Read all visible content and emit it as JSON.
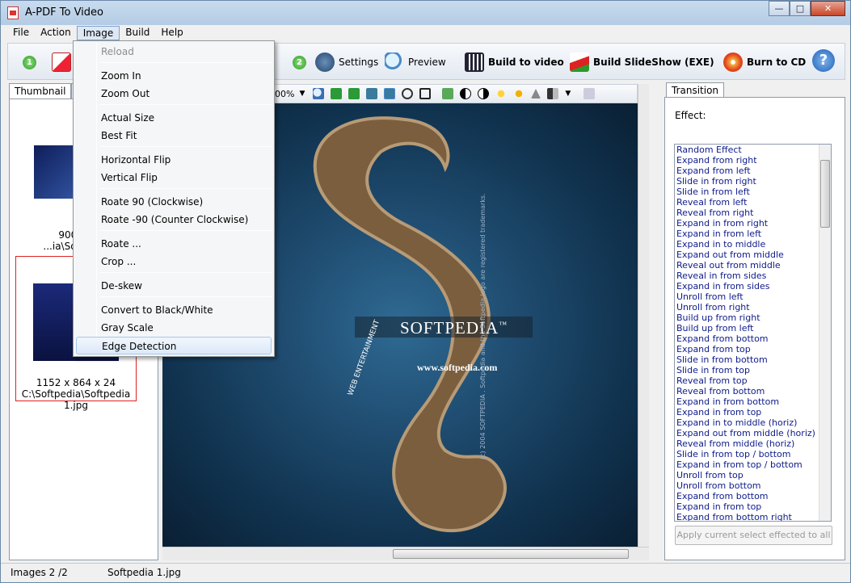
{
  "window": {
    "title": "A-PDF To Video",
    "min": "—",
    "max": "□",
    "close": "✕"
  },
  "menubar": [
    "File",
    "Action",
    "Image",
    "Build",
    "Help"
  ],
  "toolbar": {
    "step1": "1",
    "step2": "2",
    "settings": "Settings",
    "preview": "Preview",
    "build_video": "Build to video",
    "build_slideshow": "Build SlideShow (EXE)",
    "burn_cd": "Burn to CD",
    "help": "?"
  },
  "left_tabs": [
    "Thumbnail",
    "Mu"
  ],
  "thumbnails": [
    {
      "dims": "900 x 5",
      "path": "...ia\\Softpedia"
    },
    {
      "dims": "1152 x 864 x 24",
      "path": "C:\\Softpedia\\Softpedia 1.jpg"
    }
  ],
  "image_toolbar": {
    "zoom": "00%"
  },
  "canvas_text": {
    "brand": "SOFTPEDIA",
    "tm": "™",
    "web": "WEB  ENTERTAINMENT",
    "url": "www.softpedia.com",
    "side_note": "(c) 2004 SOFTPEDIA . Softpedia and the Softpedia logo are registered trademarks."
  },
  "image_menu": {
    "items": [
      {
        "label": "Reload",
        "disabled": true
      },
      {
        "label": "Zoom In"
      },
      {
        "label": "Zoom Out"
      },
      {
        "label": "Actual Size"
      },
      {
        "label": "Best Fit"
      },
      {
        "label": "Horizontal Flip"
      },
      {
        "label": "Vertical Flip"
      },
      {
        "label": "Roate 90 (Clockwise)"
      },
      {
        "label": "Roate -90 (Counter Clockwise)"
      },
      {
        "label": "Roate ..."
      },
      {
        "label": "Crop ..."
      },
      {
        "label": "De-skew"
      },
      {
        "label": "Convert to Black/White"
      },
      {
        "label": "Gray Scale"
      },
      {
        "label": "Edge Detection",
        "highlighted": true
      }
    ]
  },
  "transition": {
    "tab": "Transition",
    "effect_label": "Effect:",
    "effects": [
      "Random Effect",
      "Expand from right",
      "Expand from left",
      "Slide in from right",
      "Slide in from left",
      "Reveal from left",
      "Reveal from right",
      "Expand in from right",
      "Expand in from left",
      "Expand in to middle",
      "Expand out from middle",
      "Reveal out from middle",
      "Reveal in from sides",
      "Expand in from sides",
      "Unroll from left",
      "Unroll from right",
      "Build up from right",
      "Build up from left",
      "Expand from bottom",
      "Expand from top",
      "Slide in from bottom",
      "Slide in from top",
      "Reveal from top",
      "Reveal from bottom",
      "Expand in from bottom",
      "Expand in from top",
      "Expand in to middle (horiz)",
      "Expand out from middle (horiz)",
      "Reveal from middle (horiz)",
      "Slide in from top / bottom",
      "Expand in from top / bottom",
      "Unroll from top",
      "Unroll from bottom",
      "Expand from bottom",
      "Expand in from top",
      "Expand from bottom right"
    ],
    "apply_button": "Apply current select effected to all"
  },
  "status": {
    "images": "Images 2 /2",
    "file": "Softpedia 1.jpg"
  }
}
